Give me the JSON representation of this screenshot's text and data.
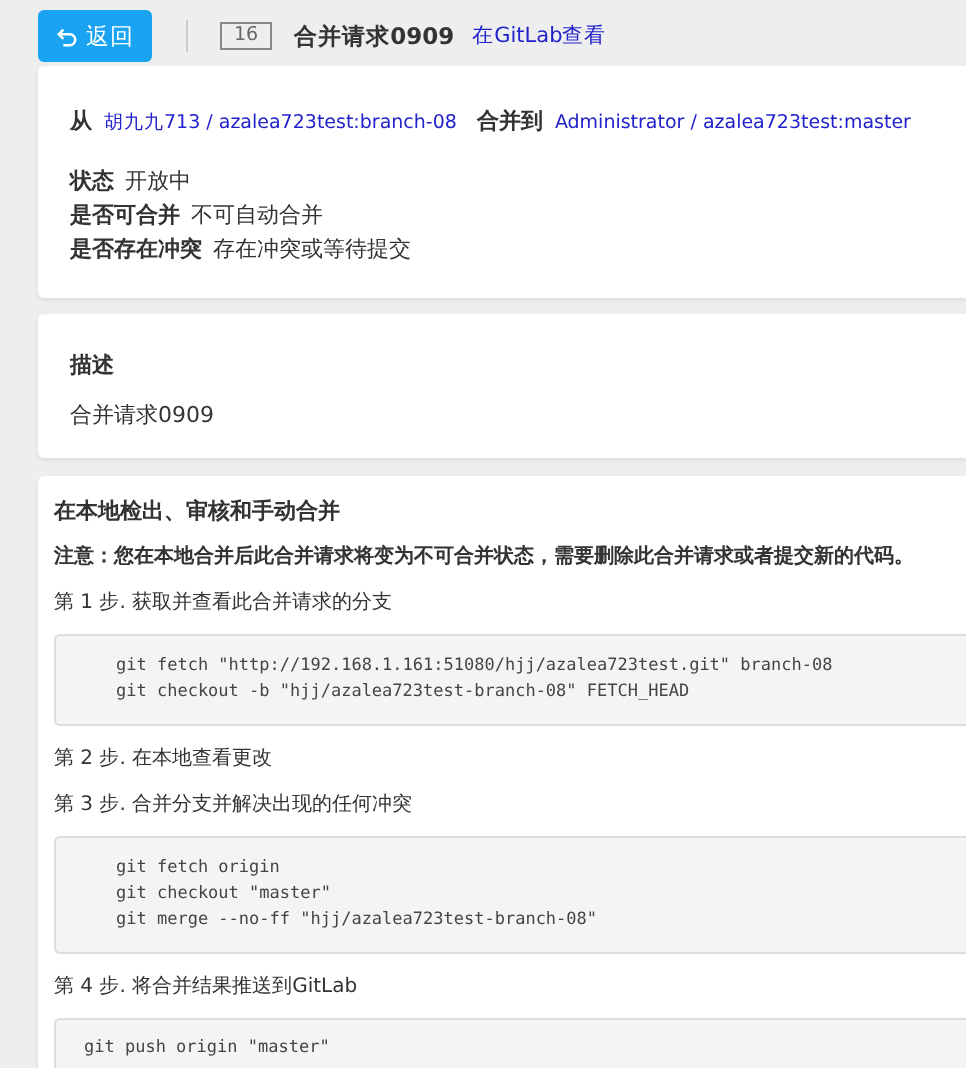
{
  "header": {
    "back_button": "返回",
    "id_badge": "16",
    "title": "合并请求0909",
    "gitlab_link": "在GitLab查看"
  },
  "summary": {
    "from_label": "从",
    "from_value": "胡九九713 / azalea723test:branch-08",
    "to_label": "合并到",
    "to_value": "Administrator / azalea723test:master",
    "fields": [
      {
        "label": "状态",
        "value": "开放中"
      },
      {
        "label": "是否可合并",
        "value": "不可自动合并"
      },
      {
        "label": "是否存在冲突",
        "value": "存在冲突或等待提交"
      }
    ]
  },
  "description": {
    "heading": "描述",
    "text": "合并请求0909"
  },
  "local_merge": {
    "heading": "在本地检出、审核和手动合并",
    "notice": "注意：您在本地合并后此合并请求将变为不可合并状态，需要删除此合并请求或者提交新的代码。",
    "steps": [
      {
        "label": "第 1 步. 获取并查看此合并请求的分支",
        "kind": "indented",
        "code": [
          "git fetch \"http://192.168.1.161:51080/hjj/azalea723test.git\" branch-08",
          "git checkout -b \"hjj/azalea723test-branch-08\" FETCH_HEAD"
        ]
      },
      {
        "label": "第 2 步. 在本地查看更改"
      },
      {
        "label": "第 3 步. 合并分支并解决出现的任何冲突",
        "kind": "indented",
        "code": [
          "git fetch origin",
          "git checkout \"master\"",
          "git merge --no-ff \"hjj/azalea723test-branch-08\""
        ]
      },
      {
        "label": "第 4 步. 将合并结果推送到GitLab",
        "kind": "plain",
        "code": [
          "git push origin \"master\""
        ]
      }
    ]
  }
}
